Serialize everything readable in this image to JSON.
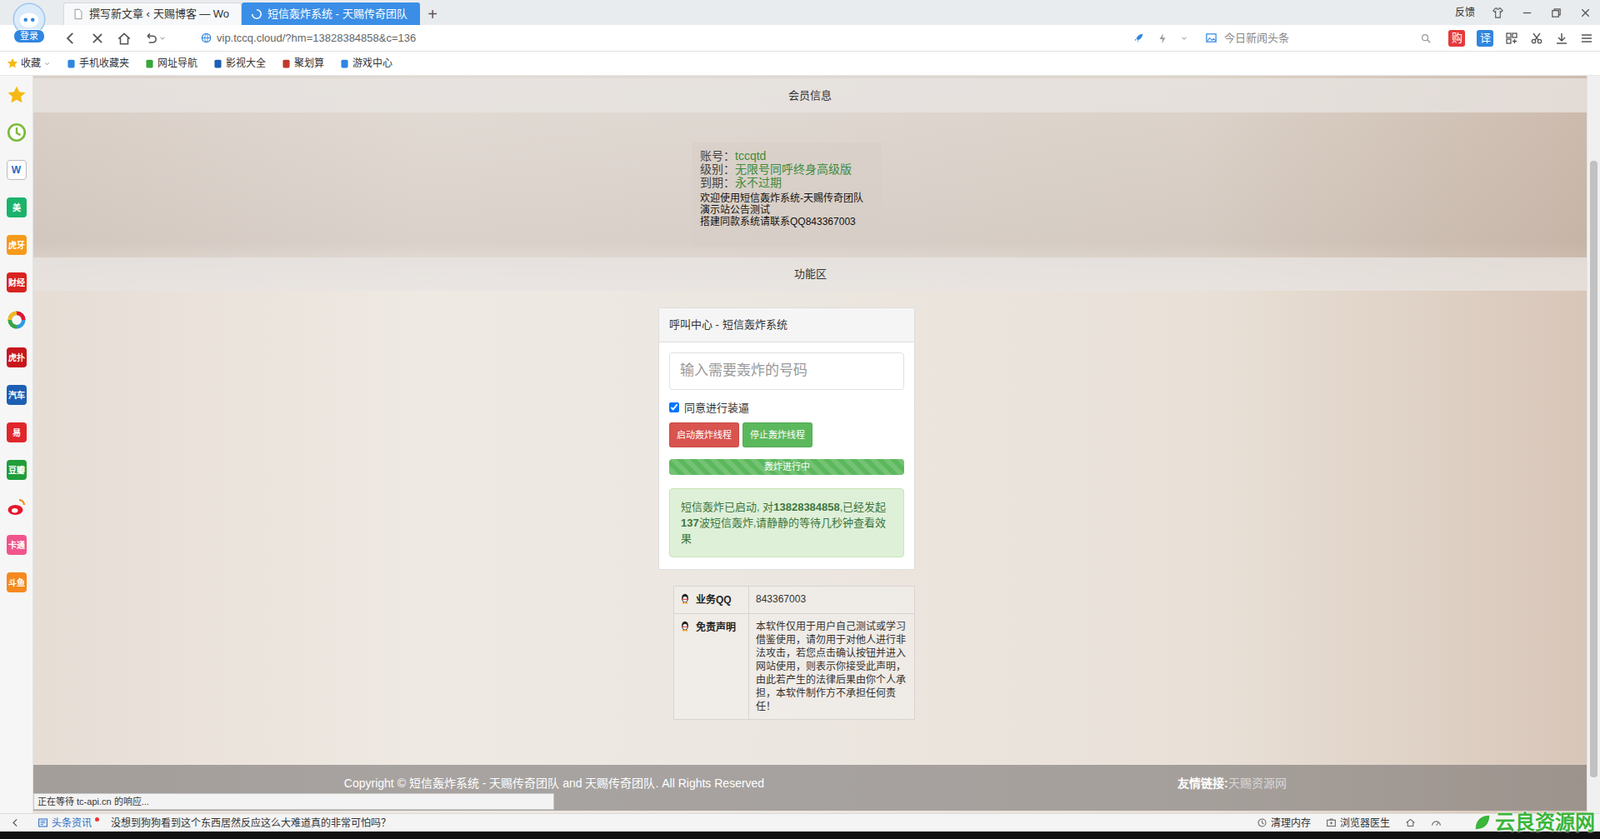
{
  "tabs": [
    {
      "label": "撰写新文章 ‹ 天赐博客 — Wo",
      "selected": false,
      "loading": false
    },
    {
      "label": "短信轰炸系统 - 天赐传奇团队",
      "selected": true,
      "loading": true
    }
  ],
  "new_tab": "+",
  "title_bar": {
    "feedback": "反馈"
  },
  "address_bar": {
    "login": "登录",
    "url": "vip.tccq.cloud/?hm=13828384858&c=136",
    "search_placeholder": "今日新闻头条",
    "shop": "购",
    "translate": "译"
  },
  "bookmarks": [
    {
      "label": "收藏",
      "color": "#f5b914"
    },
    {
      "label": "手机收藏夹",
      "color": "#2f86e0"
    },
    {
      "label": "网址导航",
      "color": "#3aa63a"
    },
    {
      "label": "影视大全",
      "color": "#1d5fb3"
    },
    {
      "label": "聚划算",
      "color": "#c0392b"
    },
    {
      "label": "游戏中心",
      "color": "#2f86e0"
    }
  ],
  "sidebar": {
    "items": [
      {
        "kind": "star",
        "color": "#f5b914"
      },
      {
        "kind": "clock",
        "color": "#7cbb3a"
      },
      {
        "kind": "doc",
        "label": "W",
        "color": "#2b6cc4"
      },
      {
        "kind": "text",
        "label": "美",
        "color": "#1bb36b"
      },
      {
        "kind": "text",
        "label": "虎牙",
        "color": "#f59a1b"
      },
      {
        "kind": "text",
        "label": "财经",
        "color": "#d8231f"
      },
      {
        "kind": "ring",
        "color": "#2f9be0"
      },
      {
        "kind": "text",
        "label": "虎扑",
        "color": "#c8161d"
      },
      {
        "kind": "text",
        "label": "汽车",
        "color": "#1d5fb3"
      },
      {
        "kind": "text",
        "label": "易",
        "color": "#e0262b"
      },
      {
        "kind": "text",
        "label": "豆瓣",
        "color": "#1f9e3a"
      },
      {
        "kind": "weibo",
        "color": "#e6162d"
      },
      {
        "kind": "text",
        "label": "卡通",
        "color": "#f0548c"
      },
      {
        "kind": "text",
        "label": "斗鱼",
        "color": "#f5891e"
      }
    ]
  },
  "page": {
    "member_header": "会员信息",
    "info": [
      {
        "label": "账号：",
        "value": "tccqtd"
      },
      {
        "label": "级别：",
        "value": "无限号同呼终身高级版"
      },
      {
        "label": "到期：",
        "value": "永不过期"
      }
    ],
    "notices": [
      "欢迎使用短信轰炸系统-天赐传奇团队",
      "演示站公告测试",
      "搭建同款系统请联系QQ843367003"
    ],
    "function_header": "功能区",
    "call": {
      "title": "呼叫中心 - 短信轰炸系统",
      "input_placeholder": "输入需要轰炸的号码",
      "agree": {
        "label": "同意进行装逼",
        "checked": true
      },
      "buttons": [
        {
          "label": "启动轰炸线程",
          "color": "#d9534f"
        },
        {
          "label": "停止轰炸线程",
          "color": "#5cb85c"
        }
      ],
      "progress": {
        "label": "轰炸进行中",
        "level": 1
      },
      "alert": [
        {
          "text": "短信轰炸已启动, 对",
          "bold": false
        },
        {
          "text": "13828384858",
          "bold": true
        },
        {
          "text": ",已经发起",
          "bold": false
        },
        {
          "text": "137",
          "bold": true
        },
        {
          "text": "波短信轰炸,请静静的等待几秒钟查看效果",
          "bold": false
        }
      ]
    },
    "info_table": [
      {
        "label": "业务QQ",
        "value": "843367003"
      },
      {
        "label": "免责声明",
        "value": "本软件仅用于用户自己测试或学习借鉴使用，请勿用于对他人进行非法攻击，若您点击确认按钮并进入网站使用，则表示你接受此声明，由此若产生的法律后果由你个人承担，本软件制作方不承担任何责任！"
      }
    ],
    "footer": {
      "copyright": "Copyright © 短信轰炸系统 - 天赐传奇团队 and 天赐传奇团队. All Rights Reserved",
      "links_label": "友情链接:",
      "link": "天赐资源网"
    }
  },
  "status_text": "正在等待 tc-api.cn 的响应...",
  "bottom_bar": {
    "news_label": "头条资讯",
    "headline": "没想到狗狗看到这个东西居然反应这么大难道真的非常可怕吗？",
    "tools": [
      "清理内存",
      "浏览器医生"
    ]
  },
  "watermark": "云良资源网"
}
